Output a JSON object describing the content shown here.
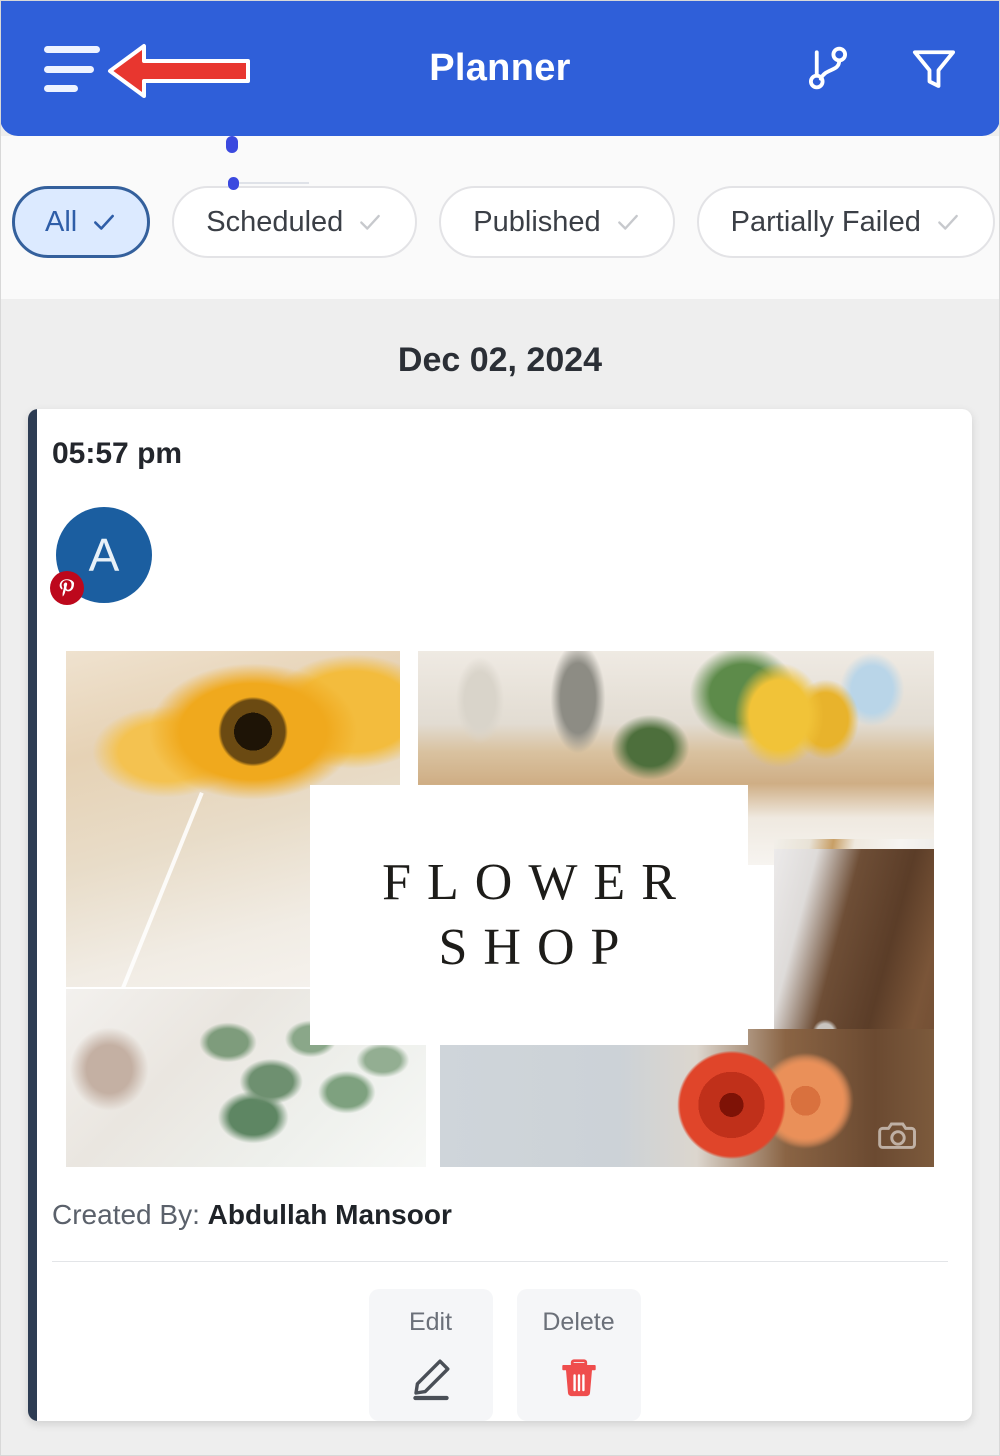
{
  "header": {
    "title": "Planner",
    "menu_icon": "hamburger-menu-icon",
    "shuffle_icon": "git-branch-icon",
    "filter_icon": "filter-funnel-icon",
    "accent_color": "#2f5fd9",
    "annotation_arrow_color": "#e8362f"
  },
  "filters": {
    "chips": [
      {
        "label": "All",
        "selected": true,
        "check_icon": "check-icon"
      },
      {
        "label": "Scheduled",
        "selected": false,
        "check_icon": "check-icon"
      },
      {
        "label": "Published",
        "selected": false,
        "check_icon": "check-icon"
      },
      {
        "label": "Partially Failed",
        "selected": false,
        "check_icon": "check-icon"
      }
    ],
    "selected_bg": "#dceaff",
    "selected_border": "#34609c",
    "selected_text": "#2f5ea8"
  },
  "feed": {
    "date_header": "Dec 02, 2024",
    "post": {
      "time": "05:57 pm",
      "avatar_letter": "A",
      "avatar_color": "#1b5ea0",
      "network_badge": "pinterest-icon",
      "network_badge_color": "#bd081c",
      "network_badge_letter": "P",
      "accent_bar_color": "#2d3c53",
      "media_alt": "flower-shop-collage",
      "logo_line1": "FLOWER",
      "logo_line2": "SHOP",
      "watermark_icon": "camera-watermark-icon",
      "created_by_label": "Created By:",
      "created_by_name": "Abdullah Mansoor",
      "actions": [
        {
          "label": "Edit",
          "icon": "pencil-icon",
          "color": "#4a4f57"
        },
        {
          "label": "Delete",
          "icon": "trash-icon",
          "color": "#ef4d4d"
        }
      ]
    }
  }
}
